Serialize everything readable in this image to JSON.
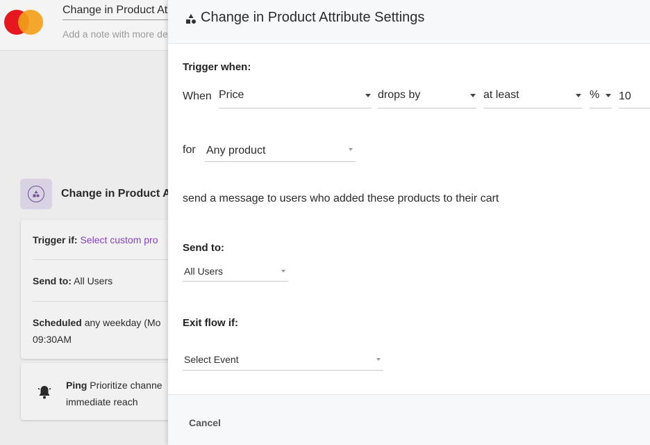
{
  "background": {
    "flow_title": "Change in Product At",
    "flow_note_placeholder": "Add a note with more de",
    "node": {
      "title": "Change in Product At",
      "trigger_label": "Trigger if:",
      "trigger_value": "Select custom pro",
      "send_label": "Send to:",
      "send_value": "All Users",
      "scheduled_label": "Scheduled",
      "scheduled_value": "any weekday (Mo",
      "scheduled_time": "09:30AM"
    },
    "ping": {
      "label": "Ping",
      "text_line1": "Prioritize channe",
      "text_line2": "immediate reach"
    },
    "colors": {
      "brand_red": "#e5181f",
      "brand_orange": "#f29f1a",
      "accent_purple": "#8a3ec9"
    }
  },
  "panel": {
    "title": "Change in Product Attribute Settings",
    "title_icon": "shapes-icon",
    "trigger_when_label": "Trigger when:",
    "when_label": "When",
    "attribute_select": "Price",
    "direction_select": "drops by",
    "comparison_select": "at least",
    "unit_select": "%",
    "amount_value": "10",
    "for_label": "for",
    "product_select": "Any product",
    "message_text": "send a message to users who added these products to their cart",
    "send_to_label": "Send to:",
    "send_to_select": "All Users",
    "exit_flow_label": "Exit flow if:",
    "exit_event_select": "Select Event",
    "cancel_label": "Cancel"
  }
}
